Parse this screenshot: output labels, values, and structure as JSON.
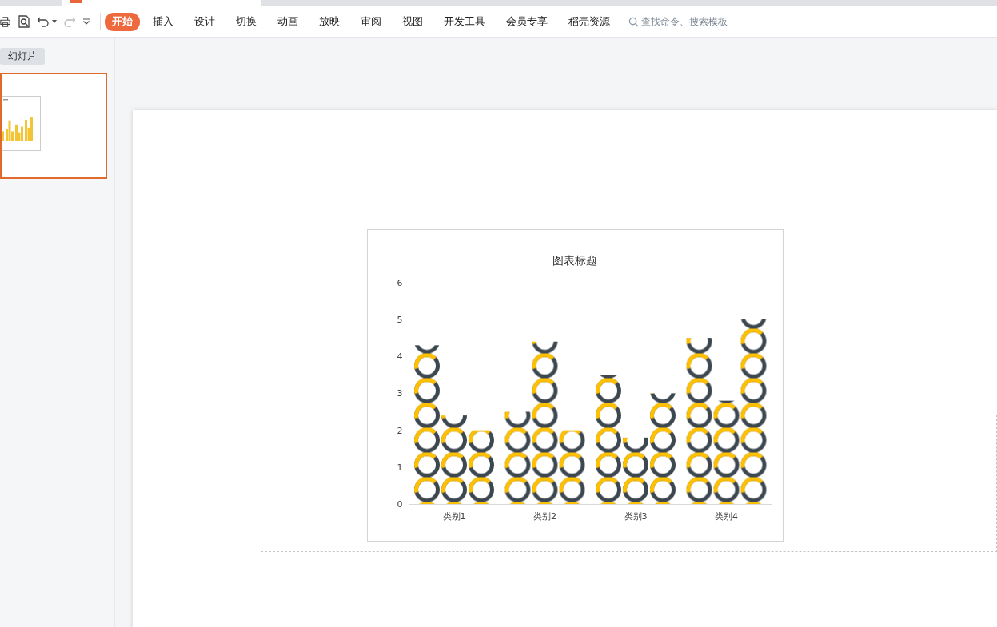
{
  "toolbar": {
    "tabs": [
      {
        "label": "开始",
        "selected": true
      },
      {
        "label": "插入",
        "selected": false
      },
      {
        "label": "设计",
        "selected": false
      },
      {
        "label": "切换",
        "selected": false
      },
      {
        "label": "动画",
        "selected": false
      },
      {
        "label": "放映",
        "selected": false
      },
      {
        "label": "审阅",
        "selected": false
      },
      {
        "label": "视图",
        "selected": false
      },
      {
        "label": "开发工具",
        "selected": false
      },
      {
        "label": "会员专享",
        "selected": false
      },
      {
        "label": "稻壳资源",
        "selected": false
      }
    ],
    "search": {
      "placeholder": "查找命令、搜索模板"
    }
  },
  "sidebar": {
    "tab": "幻灯片",
    "slides": [
      {
        "selected": true
      }
    ]
  },
  "slide": {
    "chart": {
      "chart_data": {
        "type": "bar",
        "title": "图表标题",
        "categories": [
          "类别1",
          "类别2",
          "类别3",
          "类别4"
        ],
        "series": [
          {
            "values": [
              4.3,
              2.5,
              3.5,
              4.5
            ]
          },
          {
            "values": [
              2.4,
              4.4,
              1.8,
              2.8
            ]
          },
          {
            "values": [
              2,
              2,
              3,
              5
            ]
          }
        ],
        "ylim": [
          0,
          6
        ],
        "yticks": [
          0,
          1,
          2,
          3,
          4,
          5,
          6
        ]
      }
    }
  }
}
